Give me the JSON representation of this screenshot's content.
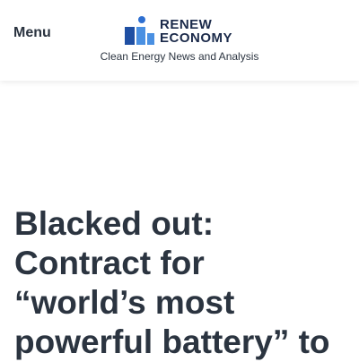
{
  "header": {
    "menu_label": "Menu",
    "logo": {
      "word_top": "RENEW",
      "word_bottom": "ECONOMY",
      "colors": {
        "dark_block": "#1f4fa3",
        "light_block": "#4a90e2",
        "dot": "#2e6fd1",
        "text": "#1b2a4a"
      }
    },
    "tagline": "Clean Energy News and Analysis"
  },
  "article": {
    "headline_lines": [
      "Blacked out:",
      "Contract for",
      "“world’s most",
      "powerful battery” to"
    ]
  },
  "colors": {
    "text": "#2b3440",
    "background": "#ffffff"
  }
}
